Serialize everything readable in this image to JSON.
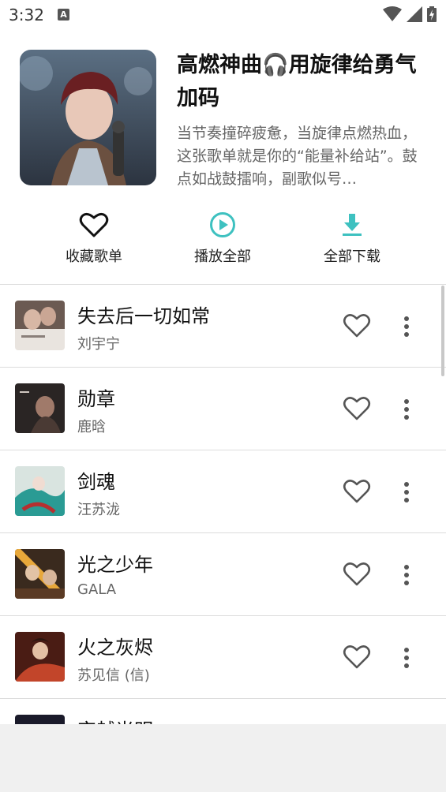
{
  "status_bar": {
    "time": "3:32",
    "notif_letter": "A"
  },
  "playlist": {
    "title": "高燃神曲🎧用旋律给勇气加码",
    "description": "当节奏撞碎疲惫，当旋律点燃热血，这张歌单就是你的“能量补给站”。鼓点如战鼓擂响，副歌似号…"
  },
  "actions": {
    "favorite": "收藏歌单",
    "play_all": "播放全部",
    "download_all": "全部下载"
  },
  "colors": {
    "accent": "#3ec1c0"
  },
  "songs": [
    {
      "name": "失去后一切如常",
      "artist": "刘宇宁"
    },
    {
      "name": "勋章",
      "artist": "鹿晗"
    },
    {
      "name": "剑魂",
      "artist": "汪苏泷"
    },
    {
      "name": "光之少年",
      "artist": "GALA"
    },
    {
      "name": "火之灰烬",
      "artist": "苏见信 (信)"
    },
    {
      "name": "穿越光明",
      "artist": ""
    }
  ]
}
